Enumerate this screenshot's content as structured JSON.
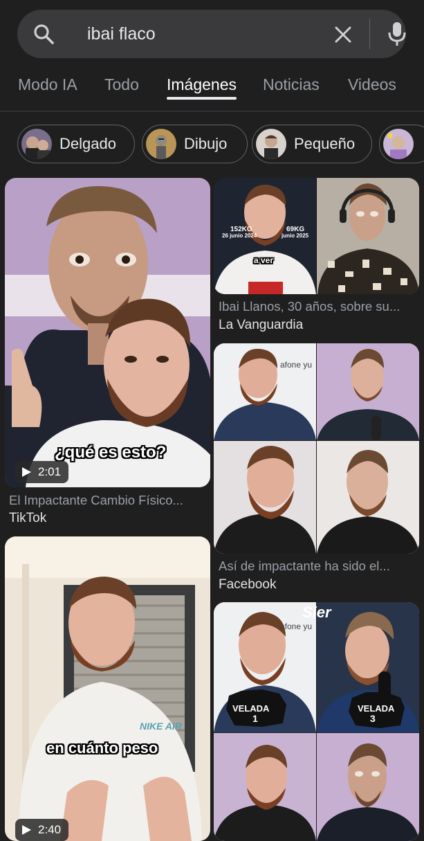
{
  "search": {
    "query": "ibai flaco",
    "icons": {
      "search": "search-icon",
      "clear": "close-icon",
      "voice": "mic-icon"
    }
  },
  "tabs": [
    {
      "label": "Modo IA",
      "active": false
    },
    {
      "label": "Todo",
      "active": false
    },
    {
      "label": "Imágenes",
      "active": true
    },
    {
      "label": "Noticias",
      "active": false
    },
    {
      "label": "Videos",
      "active": false
    }
  ],
  "chips": [
    {
      "label": "Delgado"
    },
    {
      "label": "Dibujo"
    },
    {
      "label": "Pequeño"
    },
    {
      "label": ""
    }
  ],
  "results": {
    "left": [
      {
        "title": "El Impactante Cambio Físico...",
        "source": "TikTok",
        "duration": "2:01",
        "caption": "¿qué es esto?"
      },
      {
        "title": "",
        "source": "",
        "duration": "2:40",
        "caption": "en cuánto peso",
        "shirt_text": "NIKE AIR"
      }
    ],
    "right": [
      {
        "title": "Ibai Llanos, 30 años, sobre su...",
        "source": "La Vanguardia",
        "overlay": {
          "left_weight": "152KG",
          "left_date": "26 junio 2024",
          "right_weight": "69KG",
          "right_date": "junio 2025",
          "caption": "a ver"
        }
      },
      {
        "title": "Así de impactante ha sido el...",
        "source": "Facebook",
        "overlay": {
          "banner": "afone yu"
        }
      },
      {
        "title": "",
        "source": "",
        "overlay": {
          "watermark": "Sier",
          "badge1": "VELADA",
          "badge1_num": "1",
          "badge2": "VELADA",
          "badge2_num": "3",
          "banner": "afone yu"
        }
      }
    ]
  },
  "colors": {
    "background": "#1f1f1f",
    "search_bg": "#3a3a3c",
    "active_tab": "#ffffff",
    "inactive_tab": "#9aa0a6"
  }
}
